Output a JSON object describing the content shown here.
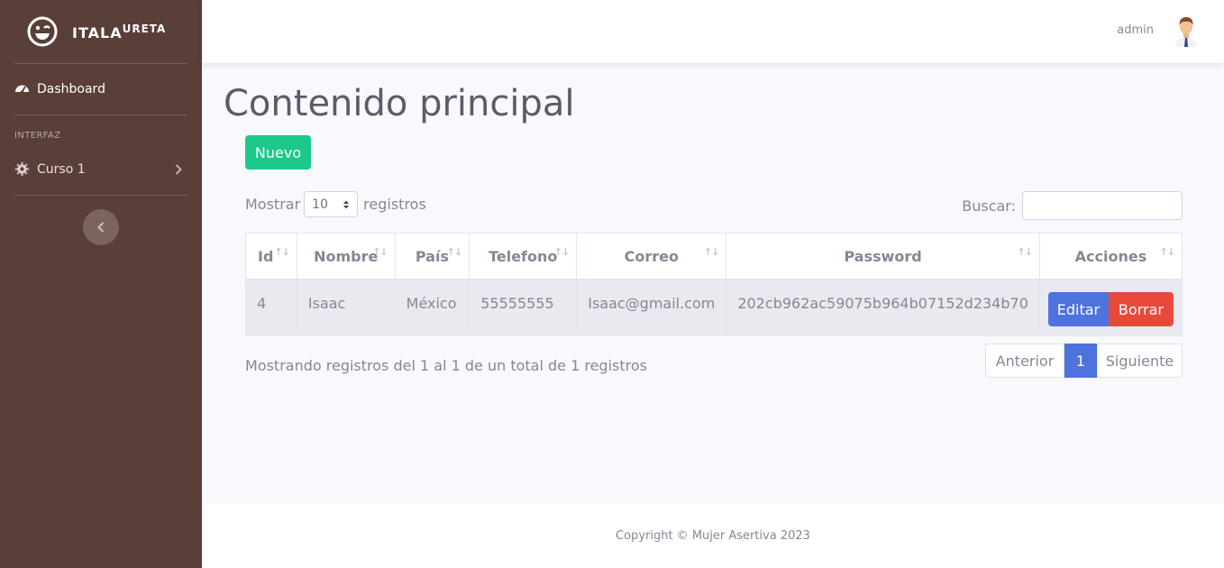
{
  "brand": {
    "name_main": "ITALA",
    "name_sup": "URETA"
  },
  "sidebar": {
    "dashboard_label": "Dashboard",
    "heading": "INTERFAZ",
    "course_label": "Curso 1"
  },
  "topbar": {
    "user_name": "admin"
  },
  "main": {
    "title": "Contenido principal",
    "new_button": "Nuevo",
    "show_label": "Mostrar",
    "page_size": "10",
    "records_label": "registros",
    "search_label": "Buscar:",
    "search_value": ""
  },
  "table": {
    "headers": [
      "Id",
      "Nombre",
      "País",
      "Telefono",
      "Correo",
      "Password",
      "Acciones"
    ],
    "rows": [
      {
        "id": "4",
        "nombre": "Isaac",
        "pais": "México",
        "telefono": "55555555",
        "correo": "Isaac@gmail.com",
        "password": "202cb962ac59075b964b07152d234b70"
      }
    ],
    "edit_label": "Editar",
    "delete_label": "Borrar"
  },
  "info_text": "Mostrando registros del 1 al 1 de un total de 1 registros",
  "pagination": {
    "prev": "Anterior",
    "current": "1",
    "next": "Siguiente"
  },
  "footer": {
    "text": "Copyright © Mujer Asertiva 2023"
  },
  "colors": {
    "sidebar_bg": "#5a3e38",
    "success": "#1cc88a",
    "primary": "#4e73df",
    "danger": "#e74a3b"
  }
}
